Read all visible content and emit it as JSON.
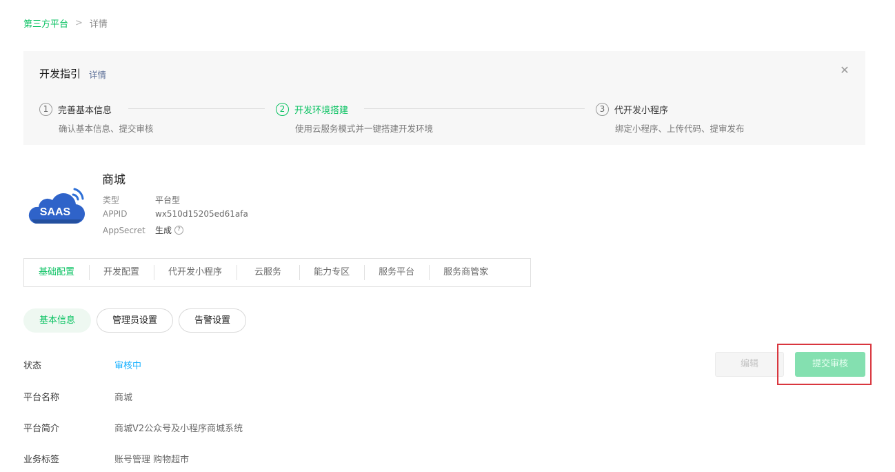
{
  "breadcrumb": {
    "parent": "第三方平台",
    "separator": ">",
    "current": "详情"
  },
  "guide": {
    "title": "开发指引",
    "detail_link": "详情",
    "close_icon": "close-icon",
    "steps": [
      {
        "num": "1",
        "title": "完善基本信息",
        "desc": "确认基本信息、提交审核"
      },
      {
        "num": "2",
        "title": "开发环境搭建",
        "desc": "使用云服务模式并一键搭建开发环境"
      },
      {
        "num": "3",
        "title": "代开发小程序",
        "desc": "绑定小程序、上传代码、提审发布"
      }
    ]
  },
  "app": {
    "logo_text": "SAAS",
    "name": "商城",
    "type_label": "类型",
    "type_value": "平台型",
    "appid_label": "APPID",
    "appid_value": "wx510d15205ed61afa",
    "secret_label": "AppSecret",
    "secret_action": "生成",
    "help_icon": "?"
  },
  "tabs": [
    "基础配置",
    "开发配置",
    "代开发小程序",
    "云服务",
    "能力专区",
    "服务平台",
    "服务商管家"
  ],
  "subtabs": [
    "基本信息",
    "管理员设置",
    "告警设置"
  ],
  "fields": {
    "status": {
      "label": "状态",
      "value": "审核中"
    },
    "name": {
      "label": "平台名称",
      "value": "商城"
    },
    "intro": {
      "label": "平台简介",
      "value": "商城V2公众号及小程序商城系统"
    },
    "tags": {
      "label": "业务标签",
      "value": "账号管理 购物超市"
    }
  },
  "actions": {
    "edit": "编辑",
    "submit": "提交审核"
  },
  "colors": {
    "accent": "#07c160",
    "status": "#10aeff",
    "highlight": "#d9363e"
  }
}
